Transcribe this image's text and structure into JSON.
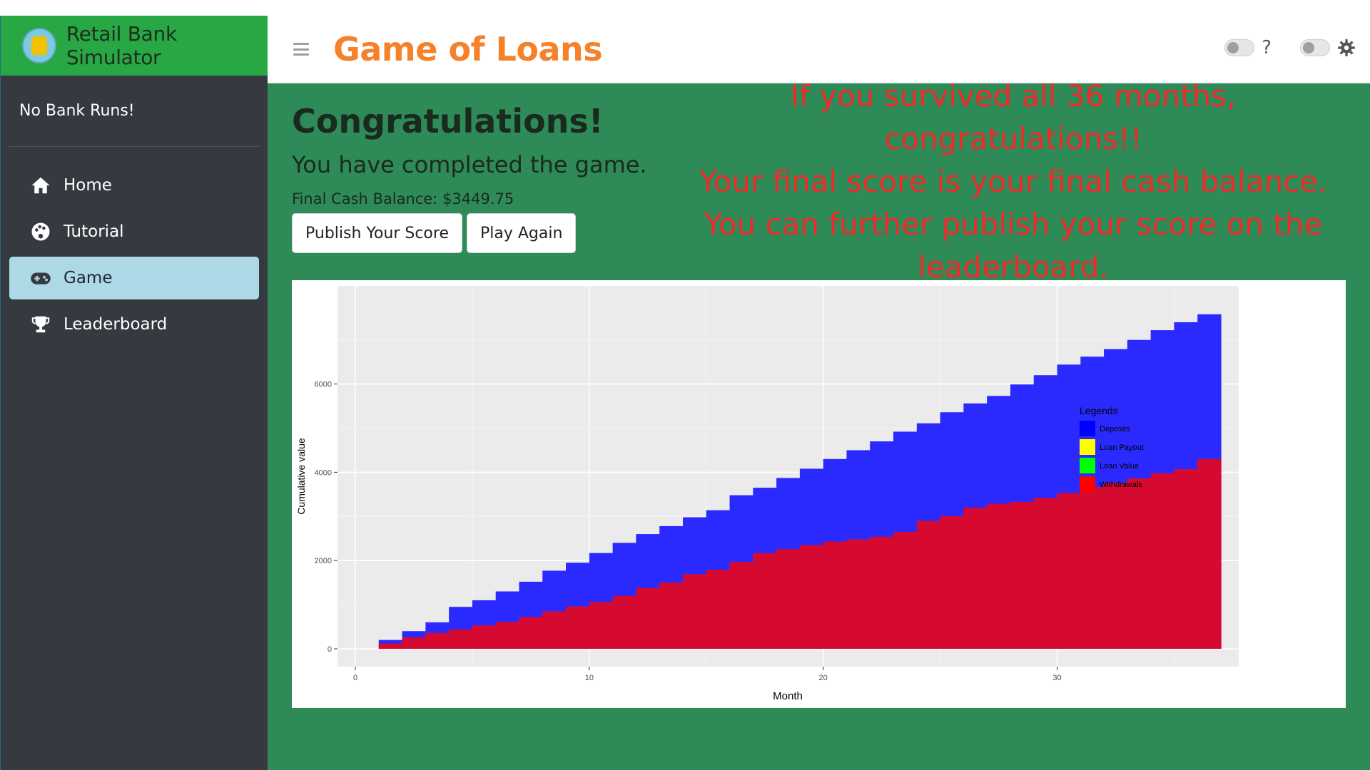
{
  "sidebar": {
    "brand": "Retail Bank Simulator",
    "status": "No Bank Runs!",
    "items": [
      {
        "label": "Home",
        "icon": "home-icon"
      },
      {
        "label": "Tutorial",
        "icon": "palette-icon"
      },
      {
        "label": "Game",
        "icon": "gamepad-icon"
      },
      {
        "label": "Leaderboard",
        "icon": "trophy-icon"
      }
    ]
  },
  "header": {
    "title": "Game of Loans",
    "help": "?"
  },
  "main": {
    "heading": "Congratulations!",
    "subheading": "You have completed the game.",
    "balance": "Final Cash Balance: $3449.75",
    "publish_label": "Publish Your Score",
    "play_again_label": "Play Again",
    "message_lines": [
      "If you survived all 36 months,",
      "congratulations!!",
      "Your final score is your final cash balance.",
      "You can further publish your score on the",
      "leaderboard."
    ]
  },
  "colors": {
    "accent": "#f5822a",
    "content_bg": "#2e8b57",
    "brand_bg": "#28a745",
    "active_nav": "#add8e6",
    "message": "#ee2a2a"
  },
  "chart_data": {
    "type": "area",
    "xlabel": "Month",
    "ylabel": "Cumulative value",
    "xlim": [
      0,
      37
    ],
    "ylim": [
      0,
      7900
    ],
    "x_ticks": [
      0,
      10,
      20,
      30
    ],
    "y_ticks": [
      0,
      2000,
      4000,
      6000
    ],
    "legend_title": "Legends",
    "legend": [
      {
        "name": "Deposits",
        "color": "#0000ff"
      },
      {
        "name": "Loan Payout",
        "color": "#ffff00"
      },
      {
        "name": "Loan Value",
        "color": "#00ff00"
      },
      {
        "name": "Withdrawals",
        "color": "#ff0000"
      }
    ],
    "x": [
      1,
      2,
      3,
      4,
      5,
      6,
      7,
      8,
      9,
      10,
      11,
      12,
      13,
      14,
      15,
      16,
      17,
      18,
      19,
      20,
      21,
      22,
      23,
      24,
      25,
      26,
      27,
      28,
      29,
      30,
      31,
      32,
      33,
      34,
      35,
      36
    ],
    "series": [
      {
        "name": "Deposits",
        "color": "#2a2aff",
        "values": [
          200,
          400,
          600,
          950,
          1100,
          1300,
          1520,
          1770,
          1950,
          2170,
          2400,
          2600,
          2780,
          2980,
          3140,
          3480,
          3650,
          3870,
          4080,
          4300,
          4500,
          4700,
          4920,
          5110,
          5360,
          5560,
          5730,
          5990,
          6200,
          6440,
          6620,
          6790,
          7000,
          7220,
          7400,
          7580
        ]
      },
      {
        "name": "Withdrawals",
        "color": "#d60a30",
        "values": [
          120,
          260,
          360,
          440,
          530,
          610,
          720,
          850,
          960,
          1060,
          1200,
          1380,
          1500,
          1690,
          1790,
          1970,
          2170,
          2260,
          2350,
          2430,
          2480,
          2540,
          2650,
          2900,
          3010,
          3200,
          3290,
          3330,
          3420,
          3530,
          3670,
          3760,
          3860,
          3980,
          4070,
          4300
        ]
      }
    ]
  }
}
